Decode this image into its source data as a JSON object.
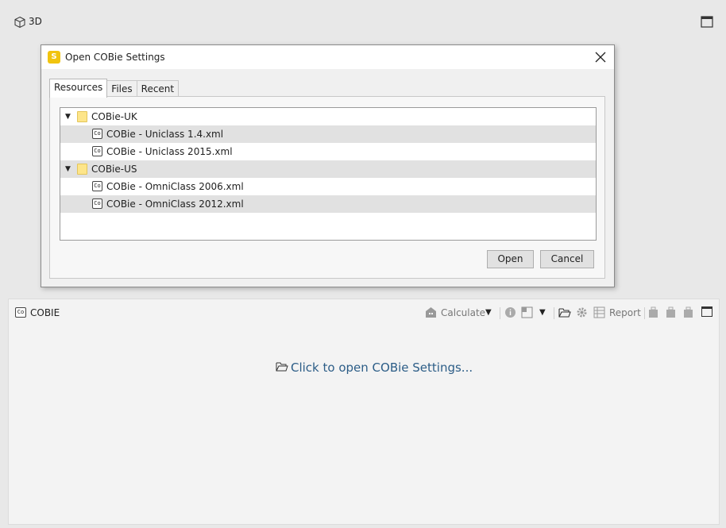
{
  "panel3d": {
    "title": "3D",
    "icon": "cube-icon"
  },
  "dialog": {
    "title": "Open COBie Settings",
    "app_icon_letter": "S",
    "tabs": [
      {
        "label": "Resources",
        "active": true
      },
      {
        "label": "Files",
        "active": false
      },
      {
        "label": "Recent",
        "active": false
      }
    ],
    "tree": [
      {
        "type": "folder",
        "label": "COBie-UK",
        "expander": "▼",
        "children": [
          {
            "type": "file",
            "label": "COBie - Uniclass 1.4.xml",
            "icon": "Co"
          },
          {
            "type": "file",
            "label": "COBie - Uniclass 2015.xml",
            "icon": "Co"
          }
        ]
      },
      {
        "type": "folder",
        "label": "COBie-US",
        "expander": "▼",
        "children": [
          {
            "type": "file",
            "label": "COBie - OmniClass 2006.xml",
            "icon": "Co"
          },
          {
            "type": "file",
            "label": "COBie - OmniClass 2012.xml",
            "icon": "Co"
          }
        ]
      }
    ],
    "open_label": "Open",
    "cancel_label": "Cancel"
  },
  "cobie_panel": {
    "title": "COBIE",
    "icon_text": "Co",
    "toolbar": {
      "calculate_label": "Calculate",
      "report_label": "Report"
    },
    "open_link": "Click to open COBie Settings..."
  },
  "colors": {
    "link": "#2c5d87",
    "folder": "#fde58a",
    "app_icon": "#f1c40f"
  }
}
